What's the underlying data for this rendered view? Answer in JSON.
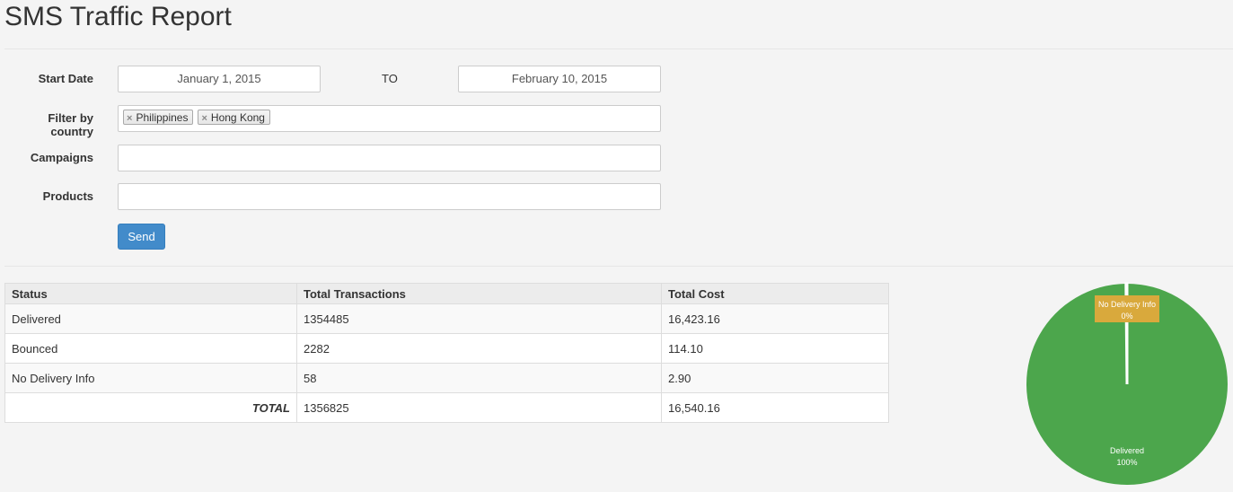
{
  "page": {
    "title": "SMS Traffic Report"
  },
  "form": {
    "start_date_label": "Start Date",
    "start_date_value": "January 1, 2015",
    "to_label": "TO",
    "end_date_value": "February 10, 2015",
    "country_label": "Filter by country",
    "countries": [
      "Philippines",
      "Hong Kong"
    ],
    "campaigns_label": "Campaigns",
    "products_label": "Products",
    "send_label": "Send"
  },
  "table": {
    "headers": [
      "Status",
      "Total Transactions",
      "Total Cost"
    ],
    "rows": [
      [
        "Delivered",
        "1354485",
        "16,423.16"
      ],
      [
        "Bounced",
        "2282",
        "114.10"
      ],
      [
        "No Delivery Info",
        "58",
        "2.90"
      ]
    ],
    "total": [
      "TOTAL",
      "1356825",
      "16,540.16"
    ]
  },
  "chart_data": {
    "type": "pie",
    "slices": [
      {
        "name": "Delivered",
        "value": 1354485,
        "label": "100%",
        "color": "#4ca64c"
      },
      {
        "name": "Bounced",
        "value": 2282,
        "label": "",
        "color": "#e2e2e2"
      },
      {
        "name": "No Delivery Info",
        "value": 58,
        "label": "0%",
        "color": "#d9a93c"
      }
    ],
    "legend": "none"
  },
  "colors": {
    "primary": "#428bca",
    "page_bg": "#f4f4f4"
  }
}
